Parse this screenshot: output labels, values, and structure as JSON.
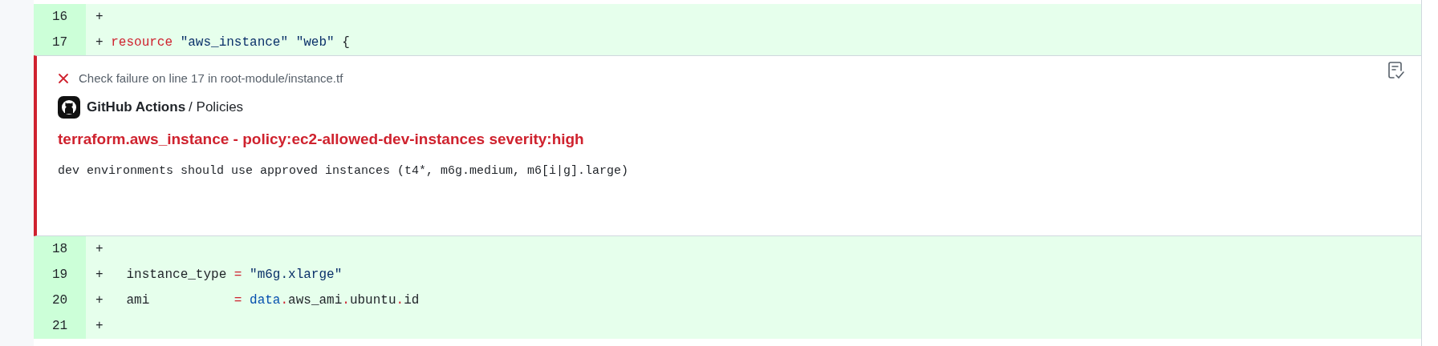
{
  "lines_before": [
    {
      "number": "16",
      "sign": "+"
    },
    {
      "number": "17",
      "sign": "+",
      "tokens": [
        {
          "kind": "keyword",
          "text": "resource"
        },
        {
          "kind": "string",
          "text": " \"aws_instance\""
        },
        {
          "kind": "string",
          "text": " \"web\""
        },
        {
          "kind": "plain",
          "text": " {"
        }
      ]
    }
  ],
  "annotation": {
    "kind": "failure",
    "heading": "Check failure on line 17 in root-module/instance.tf",
    "app_name": "GitHub Actions",
    "check_name": "/ Policies",
    "title": "terraform.aws_instance - policy:ec2-allowed-dev-instances severity:high",
    "message": "dev environments should use approved instances (t4*, m6g.medium, m6[i|g].large)"
  },
  "lines_after": [
    {
      "number": "18",
      "sign": "+"
    },
    {
      "number": "19",
      "sign": "+",
      "tokens": [
        {
          "kind": "plain",
          "text": "  instance_type "
        },
        {
          "kind": "operator",
          "text": "="
        },
        {
          "kind": "string",
          "text": " \"m6g.xlarge\""
        }
      ]
    },
    {
      "number": "20",
      "sign": "+",
      "tokens": [
        {
          "kind": "plain",
          "text": "  ami           "
        },
        {
          "kind": "operator",
          "text": "="
        },
        {
          "kind": "entity",
          "text": " data"
        },
        {
          "kind": "operator",
          "text": "."
        },
        {
          "kind": "plain",
          "text": "aws_ami"
        },
        {
          "kind": "operator",
          "text": "."
        },
        {
          "kind": "plain",
          "text": "ubuntu"
        },
        {
          "kind": "operator",
          "text": "."
        },
        {
          "kind": "plain",
          "text": "id"
        }
      ]
    },
    {
      "number": "21",
      "sign": "+"
    }
  ]
}
